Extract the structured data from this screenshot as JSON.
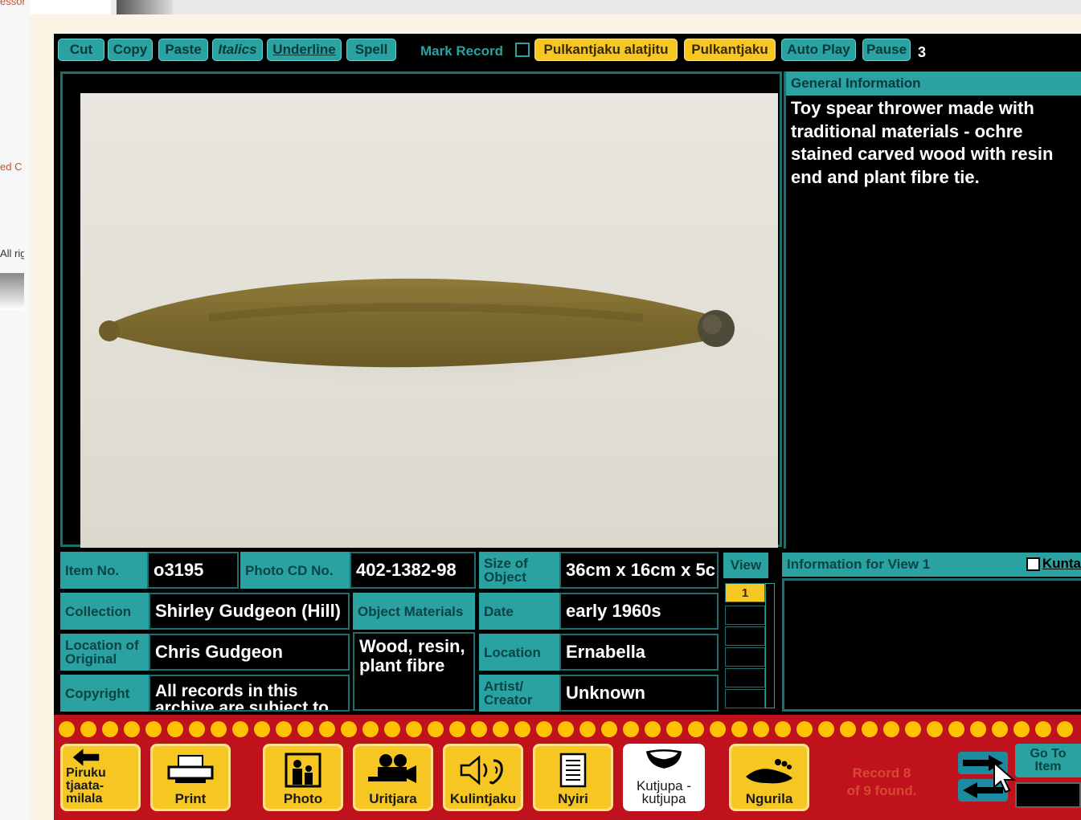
{
  "background": {
    "peek_texts": [
      "esson",
      "ed C",
      "All rig"
    ]
  },
  "toolbar": {
    "cut": "Cut",
    "copy": "Copy",
    "paste": "Paste",
    "italics": "Italics",
    "underline": "Underline",
    "spell": "Spell",
    "mark_record": "Mark Record",
    "pulkantjaku_alatjitu": "Pulkantjaku alatjitu",
    "pulkantjaku": "Pulkantjaku",
    "auto_play": "Auto Play",
    "pause": "Pause",
    "pause_value": "3"
  },
  "general_info": {
    "header": "General Information",
    "text": "Toy spear thrower made with traditional materials - ochre stained carved wood with resin end and plant fibre tie."
  },
  "fields": {
    "item_no_label": "Item No.",
    "item_no": "o3195",
    "photo_cd_label": "Photo CD No.",
    "photo_cd": "402-1382-98",
    "size_label": "Size of Object",
    "size": "36cm x 16cm x 5c",
    "collection_label": "Collection",
    "collection": "Shirley Gudgeon (Hill)",
    "materials_label": "Object Materials",
    "materials": "Wood, resin, plant fibre",
    "date_label": "Date",
    "date": "early 1960s",
    "location_original_label": "Location of Original",
    "location_original": "Chris Gudgeon",
    "location_label": "Location",
    "location": "Ernabella",
    "copyright_label": "Copyright",
    "copyright": "All records in this archive are subject to",
    "artist_label": "Artist/ Creator",
    "artist": "Unknown"
  },
  "views": {
    "header": "View",
    "selected": "1"
  },
  "info_view": {
    "header": "Information for View 1",
    "kunta": "Kunta"
  },
  "nav": {
    "piruku": "Piruku tjaata-milala",
    "print": "Print",
    "photo": "Photo",
    "uritjara": "Uritjara",
    "kulintjaku": "Kulintjaku",
    "nyiri": "Nyiri",
    "kutjupa": "Kutjupa - kutjupa",
    "ngurila": "Ngurila",
    "record_line1": "Record 8",
    "record_line2": "of 9 found.",
    "goto": "Go To Item"
  },
  "colors": {
    "teal": "#2aa2a2",
    "yellow": "#f6c623",
    "nav_red": "#c0121d",
    "dot_yellow": "#ffc200"
  }
}
